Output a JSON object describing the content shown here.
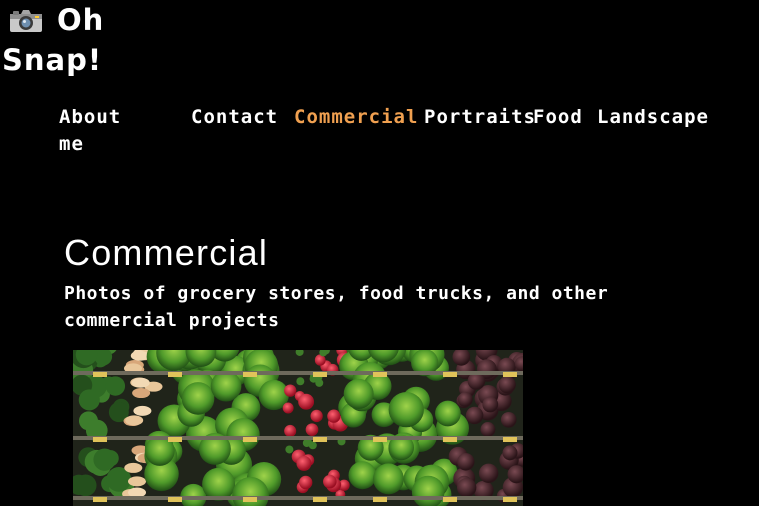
{
  "site": {
    "logo_icon": "camera-icon",
    "logo_text": "Oh Snap!"
  },
  "nav": {
    "items": [
      {
        "label": "About me"
      },
      {
        "label": "Contact"
      },
      {
        "label": "Commercial",
        "active": true
      },
      {
        "label": "Portraits"
      },
      {
        "label": "Food"
      },
      {
        "label": "Landscape"
      }
    ],
    "active_color": "#f0a050"
  },
  "page": {
    "title": "Commercial",
    "description": "Photos of grocery stores, food trucks, and other commercial projects"
  },
  "gallery": {
    "images": [
      {
        "subject": "grocery-produce-shelves"
      }
    ]
  }
}
